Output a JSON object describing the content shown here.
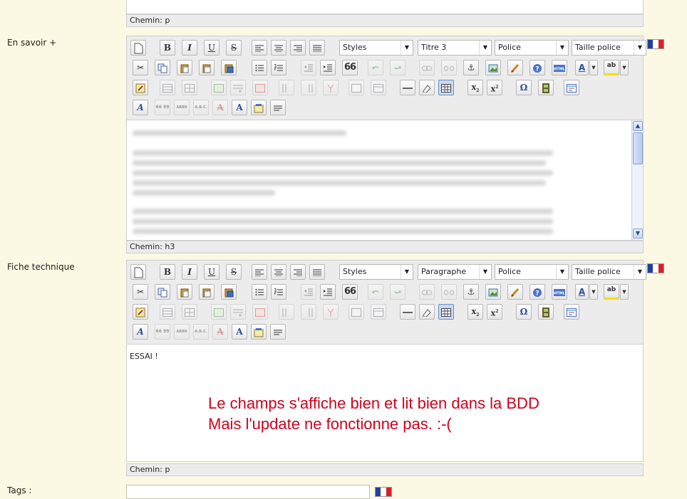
{
  "top_editor": {
    "statusbar": "Chemin: p"
  },
  "fields": [
    {
      "label": "En savoir +",
      "heading_select": "Titre 3",
      "statusbar": "Chemin: h3"
    },
    {
      "label": "Fiche technique",
      "heading_select": "Paragraphe",
      "statusbar": "Chemin: p",
      "content": "ESSAI !"
    }
  ],
  "toolbar": {
    "styles_select": "Styles",
    "font_select": "Police",
    "size_select": "Taille police",
    "bold": "B",
    "italic": "I",
    "underline": "U",
    "strike": "S",
    "quote": "66",
    "sub": "x",
    "sup": "x",
    "omega": "Ω",
    "abc": "A"
  },
  "annotation": {
    "line1": "Le champs s'affiche bien et lit bien dans la BDD",
    "line2": "Mais l'update ne fonctionne pas. :-("
  },
  "tags": {
    "label": "Tags :"
  },
  "colors": {
    "flag_blue": "#1f3fa8",
    "flag_white": "#ffffff",
    "flag_red": "#d8202a",
    "annotation": "#d0021b"
  }
}
